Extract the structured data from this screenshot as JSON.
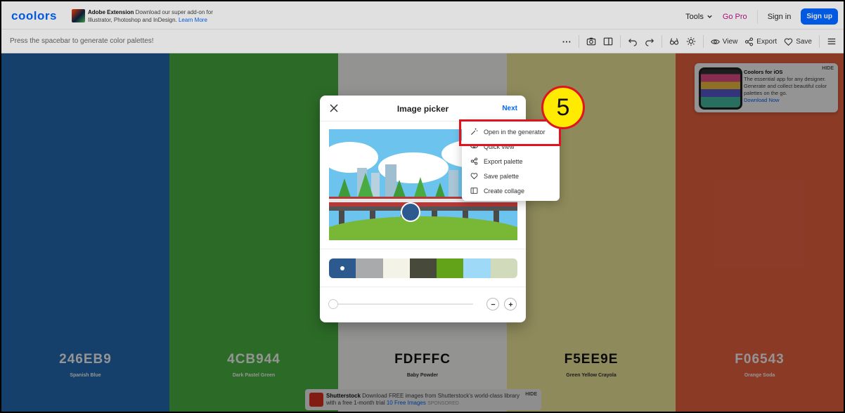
{
  "header": {
    "logo": "coolors",
    "adobe_title": "Adobe Extension",
    "adobe_desc": "Download our super add-on for Illustrator, Photoshop and InDesign.",
    "adobe_link": "Learn More",
    "tools": "Tools",
    "gopro": "Go Pro",
    "signin": "Sign in",
    "signup": "Sign up"
  },
  "toolbar": {
    "hint": "Press the spacebar to generate color palettes!",
    "more": "···",
    "view": "View",
    "export": "Export",
    "save": "Save"
  },
  "palette": [
    {
      "hex": "246EB9",
      "name": "Spanish Blue",
      "color": "#246EB9",
      "text": "#ffffff"
    },
    {
      "hex": "4CB944",
      "name": "Dark Pastel Green",
      "color": "#4CB944",
      "text": "#ffffff"
    },
    {
      "hex": "FDFFFC",
      "name": "Baby Powder",
      "color": "#FDFFFC",
      "text": "#111111"
    },
    {
      "hex": "F5EE9E",
      "name": "Green Yellow Crayola",
      "color": "#F5EE9E",
      "text": "#111111"
    },
    {
      "hex": "F06543",
      "name": "Orange Soda",
      "color": "#F06543",
      "text": "#ffffff"
    }
  ],
  "ios_promo": {
    "title": "Coolors for iOS",
    "desc": "The essential app for any designer. Generate and collect beautiful color palettes on the go.",
    "link": "Download Now",
    "hide": "HIDE"
  },
  "ad": {
    "brand": "Shutterstock",
    "text_a": "Download",
    "text_b": "FREE images from Shutterstock's world-class library with a free 1-month trial",
    "link": "10 Free Images",
    "sponsored": "SPONSORED",
    "hide": "HIDE"
  },
  "modal": {
    "title": "Image picker",
    "next": "Next",
    "swatches": [
      "#2d5a8e",
      "#a8aaab",
      "#f4f3e8",
      "#474a3a",
      "#63a31a",
      "#9ed9f7",
      "#d1dbbc"
    ]
  },
  "menu": {
    "items": [
      "Open in the generator",
      "Quick view",
      "Export palette",
      "Save palette",
      "Create collage"
    ]
  },
  "annotation": {
    "step": "5",
    "accent": "#e0141e",
    "badge": "#ffeb00"
  }
}
